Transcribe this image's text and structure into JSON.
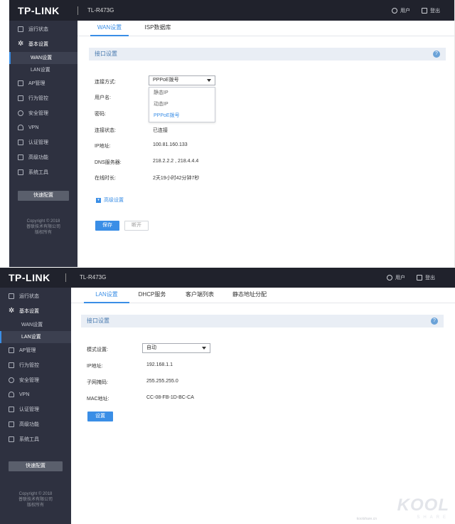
{
  "shot1": {
    "header": {
      "logo": "TP-LINK",
      "model": "TL-R473G",
      "user_label": "用户",
      "logout_label": "登出"
    },
    "sidebar": {
      "items": [
        {
          "label": "运行状态",
          "icon": "status-icon"
        },
        {
          "label": "基本设置",
          "icon": "gear-icon"
        },
        {
          "label": "AP管理",
          "icon": "ap-icon"
        },
        {
          "label": "行为管控",
          "icon": "behavior-icon"
        },
        {
          "label": "安全管理",
          "icon": "shield-icon"
        },
        {
          "label": "VPN",
          "icon": "cloud-icon"
        },
        {
          "label": "认证管理",
          "icon": "auth-icon"
        },
        {
          "label": "高级功能",
          "icon": "grid-icon"
        },
        {
          "label": "系统工具",
          "icon": "tools-icon"
        }
      ],
      "subitems": [
        {
          "label": "WAN设置"
        },
        {
          "label": "LAN设置"
        }
      ],
      "quick_config": "快速配置",
      "copyright_line1": "Copyright © 2018",
      "copyright_line2": "普联技术有限公司",
      "copyright_line3": "版权所有"
    },
    "tabs": [
      {
        "label": "WAN设置"
      },
      {
        "label": "ISP数据库"
      }
    ],
    "section_title": "接口设置",
    "help": "?",
    "form": {
      "connection_type_label": "连接方式:",
      "connection_type_value": "PPPoE拨号",
      "username_label": "用户名:",
      "password_label": "密码:",
      "status_label": "连接状态:",
      "status_value": "已连接",
      "ip_label": "IP地址:",
      "ip_value": "100.81.160.133",
      "dns_label": "DNS服务器:",
      "dns_value": "218.2.2.2 , 218.4.4.4",
      "uptime_label": "在线时长:",
      "uptime_value": "2天19小时42分钟7秒"
    },
    "dropdown_options": [
      {
        "label": "静态IP"
      },
      {
        "label": "动态IP"
      },
      {
        "label": "PPPoE拨号"
      }
    ],
    "advanced_label": "高级设置",
    "save_label": "保存",
    "disconnect_label": "断开"
  },
  "shot2": {
    "header": {
      "logo": "TP-LINK",
      "model": "TL-R473G",
      "user_label": "用户",
      "logout_label": "登出"
    },
    "sidebar": {
      "items": [
        {
          "label": "运行状态",
          "icon": "status-icon"
        },
        {
          "label": "基本设置",
          "icon": "gear-icon"
        },
        {
          "label": "AP管理",
          "icon": "ap-icon"
        },
        {
          "label": "行为管控",
          "icon": "behavior-icon"
        },
        {
          "label": "安全管理",
          "icon": "shield-icon"
        },
        {
          "label": "VPN",
          "icon": "cloud-icon"
        },
        {
          "label": "认证管理",
          "icon": "auth-icon"
        },
        {
          "label": "高级功能",
          "icon": "grid-icon"
        },
        {
          "label": "系统工具",
          "icon": "tools-icon"
        }
      ],
      "subitems": [
        {
          "label": "WAN设置"
        },
        {
          "label": "LAN设置"
        }
      ],
      "quick_config": "快速配置",
      "copyright_line1": "Copyright © 2018",
      "copyright_line2": "普联技术有限公司",
      "copyright_line3": "版权所有"
    },
    "tabs": [
      {
        "label": "LAN设置"
      },
      {
        "label": "DHCP服务"
      },
      {
        "label": "客户端列表"
      },
      {
        "label": "静态地址分配"
      }
    ],
    "section_title": "接口设置",
    "help": "?",
    "form": {
      "mode_label": "模式设置:",
      "mode_value": "自动",
      "ip_label": "IP地址:",
      "ip_value": "192.168.1.1",
      "mask_label": "子网掩码:",
      "mask_value": "255.255.255.0",
      "mac_label": "MAC地址:",
      "mac_value": "CC-08-FB-1D-BC-CA"
    },
    "settings_label": "设置",
    "watermark": {
      "brand": "KOOL",
      "sub": "SHARE",
      "url": "koolshare.cn"
    }
  },
  "colors": {
    "accent": "#3a8ee6",
    "sidebar": "#2e3140",
    "topbar": "#20222c"
  }
}
